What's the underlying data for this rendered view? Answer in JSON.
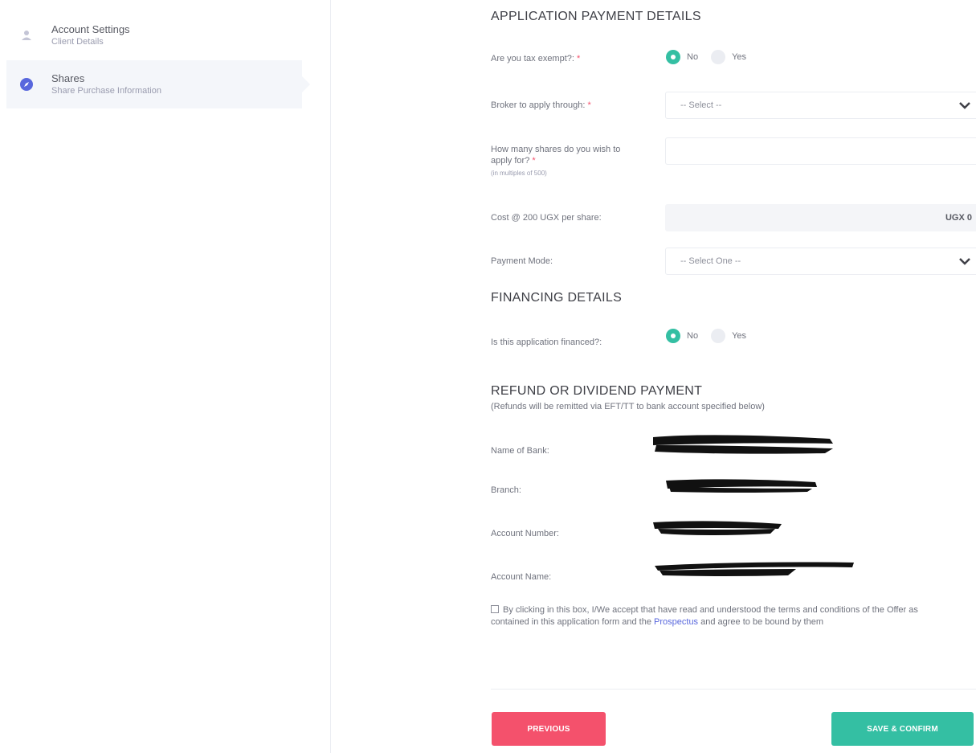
{
  "sidebar": {
    "items": [
      {
        "title": "Account Settings",
        "subtitle": "Client Details",
        "icon": "user-icon"
      },
      {
        "title": "Shares",
        "subtitle": "Share Purchase Information",
        "icon": "compass-icon"
      }
    ]
  },
  "payment": {
    "title": "APPLICATION PAYMENT DETAILS",
    "tax_exempt_label": "Are you tax exempt?:",
    "radio_no": "No",
    "radio_yes": "Yes",
    "broker_label": "Broker to apply through:",
    "broker_placeholder": "-- Select --",
    "shares_label": "How many shares do you wish to apply for?",
    "shares_hint": "(in multiples of 500)",
    "shares_value": "",
    "cost_label": "Cost @ 200 UGX per share:",
    "cost_value": "UGX 0",
    "payment_mode_label": "Payment Mode:",
    "payment_mode_placeholder": "-- Select One --",
    "required_mark": "*"
  },
  "financing": {
    "title": "FINANCING DETAILS",
    "financed_label": "Is this application financed?:",
    "radio_no": "No",
    "radio_yes": "Yes"
  },
  "refund": {
    "title": "REFUND OR DIVIDEND PAYMENT",
    "note": "(Refunds will be remitted via EFT/TT to bank account specified below)",
    "bank_label": "Name of Bank:",
    "branch_label": "Branch:",
    "account_number_label": "Account Number:",
    "account_name_label": "Account Name:"
  },
  "terms": {
    "text_before": "By clicking in this box, I/We accept that have read and understood the terms and conditions of the Offer as contained in this application form and the ",
    "link": "Prospectus",
    "text_after": " and agree to be bound by them"
  },
  "buttons": {
    "previous": "PREVIOUS",
    "save": "SAVE & CONFIRM"
  },
  "colors": {
    "accent_green": "#34bfa3",
    "danger": "#f4516c",
    "link": "#5867dd"
  }
}
